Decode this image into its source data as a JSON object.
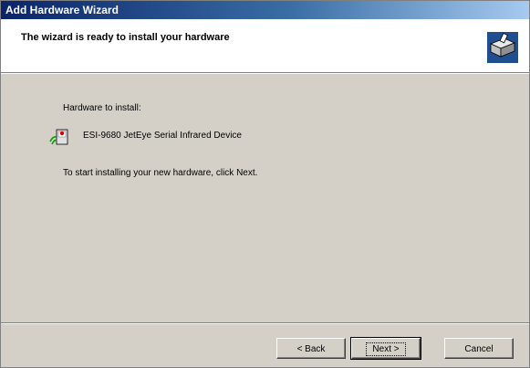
{
  "window": {
    "title": "Add Hardware Wizard"
  },
  "header": {
    "title": "The wizard is ready to install your hardware",
    "icon": "hardware-wizard-icon"
  },
  "content": {
    "hardware_label": "Hardware to install:",
    "device_name": "ESI-9680 JetEye Serial Infrared Device",
    "device_icon": "infrared-device-icon",
    "instruction": "To start installing your new hardware, click Next."
  },
  "buttons": {
    "back": "< Back",
    "next": "Next >",
    "cancel": "Cancel"
  }
}
